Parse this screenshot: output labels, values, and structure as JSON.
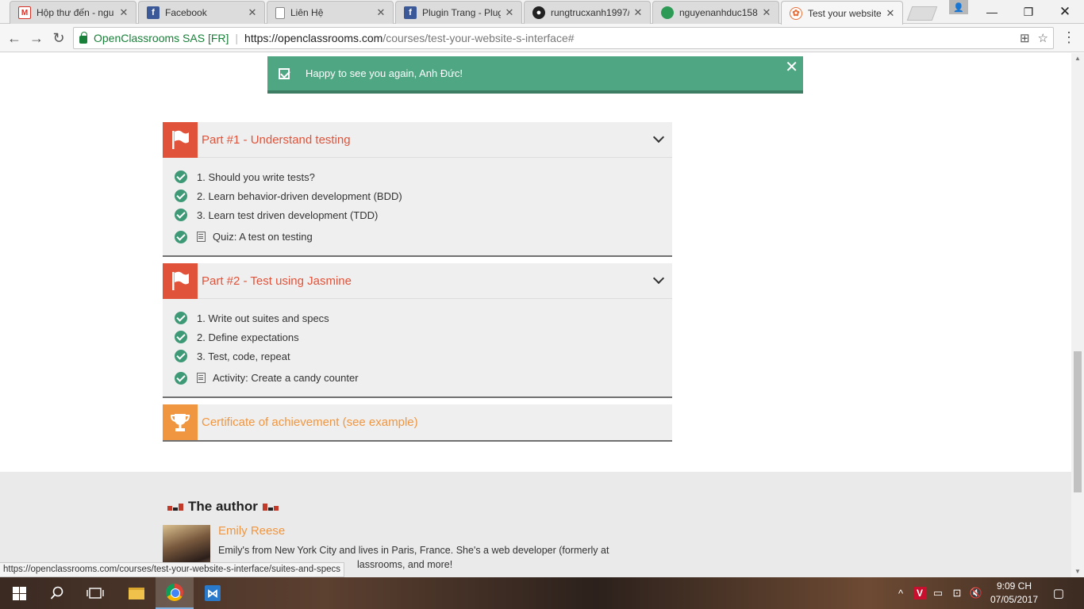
{
  "browser": {
    "tabs": [
      {
        "title": "Hộp thư đến - ngu",
        "favicon": "gmail-icon",
        "glyph": "M"
      },
      {
        "title": "Facebook",
        "favicon": "facebook-icon",
        "glyph": "f"
      },
      {
        "title": "Liên Hệ",
        "favicon": "document-icon",
        "glyph": ""
      },
      {
        "title": "Plugin Trang - Plug",
        "favicon": "facebook-icon",
        "glyph": "f"
      },
      {
        "title": "rungtrucxanh1997/",
        "favicon": "github-icon",
        "glyph": "●"
      },
      {
        "title": "nguyenanhduc158",
        "favicon": "green-circle-icon",
        "glyph": ""
      },
      {
        "title": "Test your website's",
        "favicon": "openclassrooms-icon",
        "glyph": "✿"
      }
    ],
    "tab_close": "✕",
    "window_controls": {
      "minimize": "—",
      "restore": "❐",
      "close": "✕"
    },
    "user_glyph": "👤",
    "nav": {
      "back": "←",
      "forward": "→",
      "reload": "↻"
    },
    "security_label": "OpenClassrooms SAS [FR]",
    "url_separator": "|",
    "url_host": "https://openclassrooms.com",
    "url_path": "/courses/test-your-website-s-interface#",
    "translate_glyph": "⊞",
    "star_glyph": "☆",
    "menu_glyph": "⋮"
  },
  "flash": {
    "message": "Happy to see you again, Anh Đức!",
    "close": "✕"
  },
  "parts": [
    {
      "title": "Part #1 - Understand testing",
      "chapters": [
        {
          "label": "1. Should you write tests?",
          "type": "chapter"
        },
        {
          "label": "2. Learn behavior-driven development (BDD)",
          "type": "chapter"
        },
        {
          "label": "3. Learn test driven development (TDD)",
          "type": "chapter"
        },
        {
          "label": "Quiz: A test on testing",
          "type": "quiz"
        }
      ]
    },
    {
      "title": "Part #2 - Test using Jasmine",
      "chapters": [
        {
          "label": "1. Write out suites and specs",
          "type": "chapter"
        },
        {
          "label": "2. Define expectations",
          "type": "chapter"
        },
        {
          "label": "3. Test, code, repeat",
          "type": "chapter"
        },
        {
          "label": "Activity: Create a candy counter",
          "type": "quiz"
        }
      ]
    }
  ],
  "certificate": {
    "title": "Certificate of achievement (see example)"
  },
  "author": {
    "heading": "The author",
    "name": "Emily Reese",
    "bio": "Emily's from New York City and lives in Paris, France. She's a web developer (formerly at",
    "bio_line2": "lassrooms, and more!"
  },
  "status_url": "https://openclassrooms.com/courses/test-your-website-s-interface/suites-and-specs",
  "taskbar": {
    "clock_time": "9:09 CH",
    "clock_date": "07/05/2017",
    "tray": {
      "chevron": "^",
      "antivirus": "V",
      "battery": "▭",
      "network": "⊡",
      "volume": "🔇",
      "notifications": "▢"
    }
  },
  "colors": {
    "accent_orange": "#e0533a",
    "certificate_orange": "#f19640",
    "success_green": "#4fa683",
    "check_green": "#3e9977"
  }
}
